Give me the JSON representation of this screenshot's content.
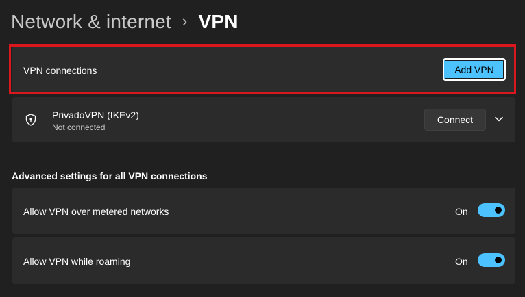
{
  "breadcrumb": {
    "parent": "Network & internet",
    "separator": "›",
    "current": "VPN"
  },
  "vpn_connections": {
    "label": "VPN connections",
    "add_button_label": "Add VPN"
  },
  "connections": [
    {
      "name": "PrivadoVPN (IKEv2)",
      "status": "Not connected",
      "connect_label": "Connect",
      "icon": "shield-icon"
    }
  ],
  "advanced": {
    "heading": "Advanced settings for all VPN connections",
    "settings": [
      {
        "label": "Allow VPN over metered networks",
        "state": "On",
        "enabled": true
      },
      {
        "label": "Allow VPN while roaming",
        "state": "On",
        "enabled": true
      }
    ]
  },
  "colors": {
    "background": "#202020",
    "card": "#2b2b2b",
    "accent": "#4cc2ff",
    "highlight": "#d9171c"
  }
}
